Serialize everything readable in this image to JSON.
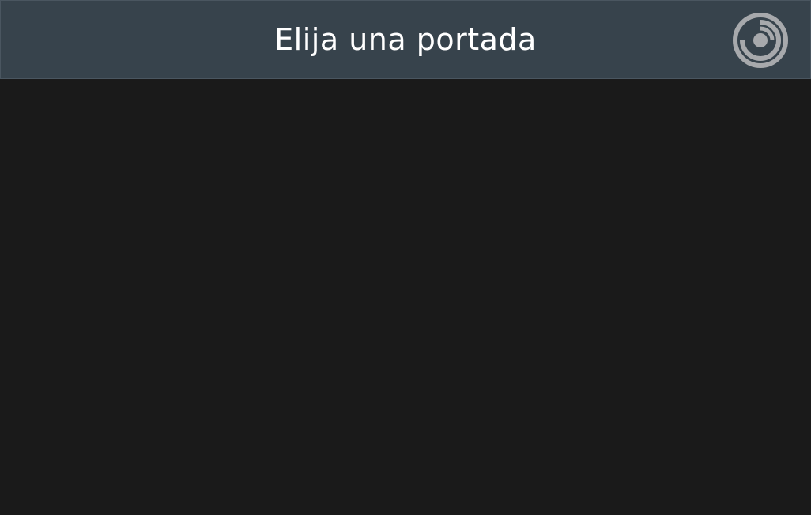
{
  "header": {
    "title": "Elija una portada",
    "logo_icon": "spiral-logo-icon"
  },
  "colors": {
    "header_bg": "#37434c",
    "content_bg": "#1a1a1a",
    "title_text": "#ffffff",
    "logo": "#a7a9ac"
  }
}
